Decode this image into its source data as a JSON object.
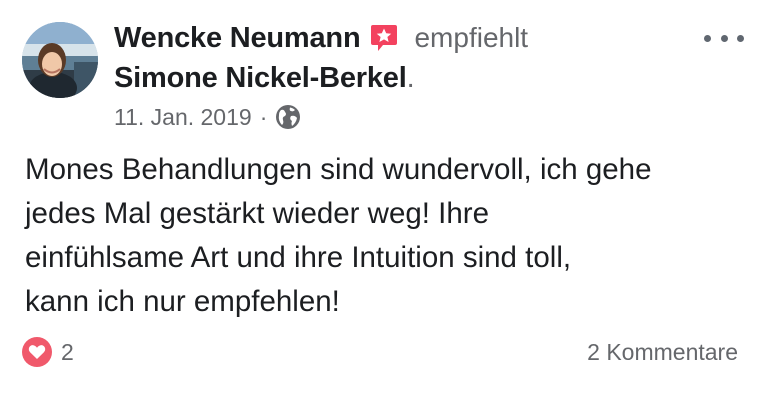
{
  "post": {
    "author": "Wencke Neumann",
    "action": "empfiehlt",
    "page": "Simone Nickel-Berkel",
    "page_suffix": ".",
    "date": "11. Jan. 2019",
    "date_separator": "·",
    "audience_icon": "globe-icon",
    "recommendation_icon": "star-recommendation-icon",
    "text": "Mones Behandlungen sind wundervoll, ich gehe\njedes Mal gestärkt wieder weg! Ihre\neinfühlsame Art und ihre Intuition sind toll,\nkann ich nur empfehlen!",
    "reaction_count": "2",
    "reaction_icon": "love-heart-icon",
    "comments": "2 Kommentare"
  },
  "colors": {
    "text_primary": "#1c1e21",
    "text_secondary": "#65676b",
    "recommend_badge": "#f3425f",
    "love_reaction": "#f0596b"
  }
}
